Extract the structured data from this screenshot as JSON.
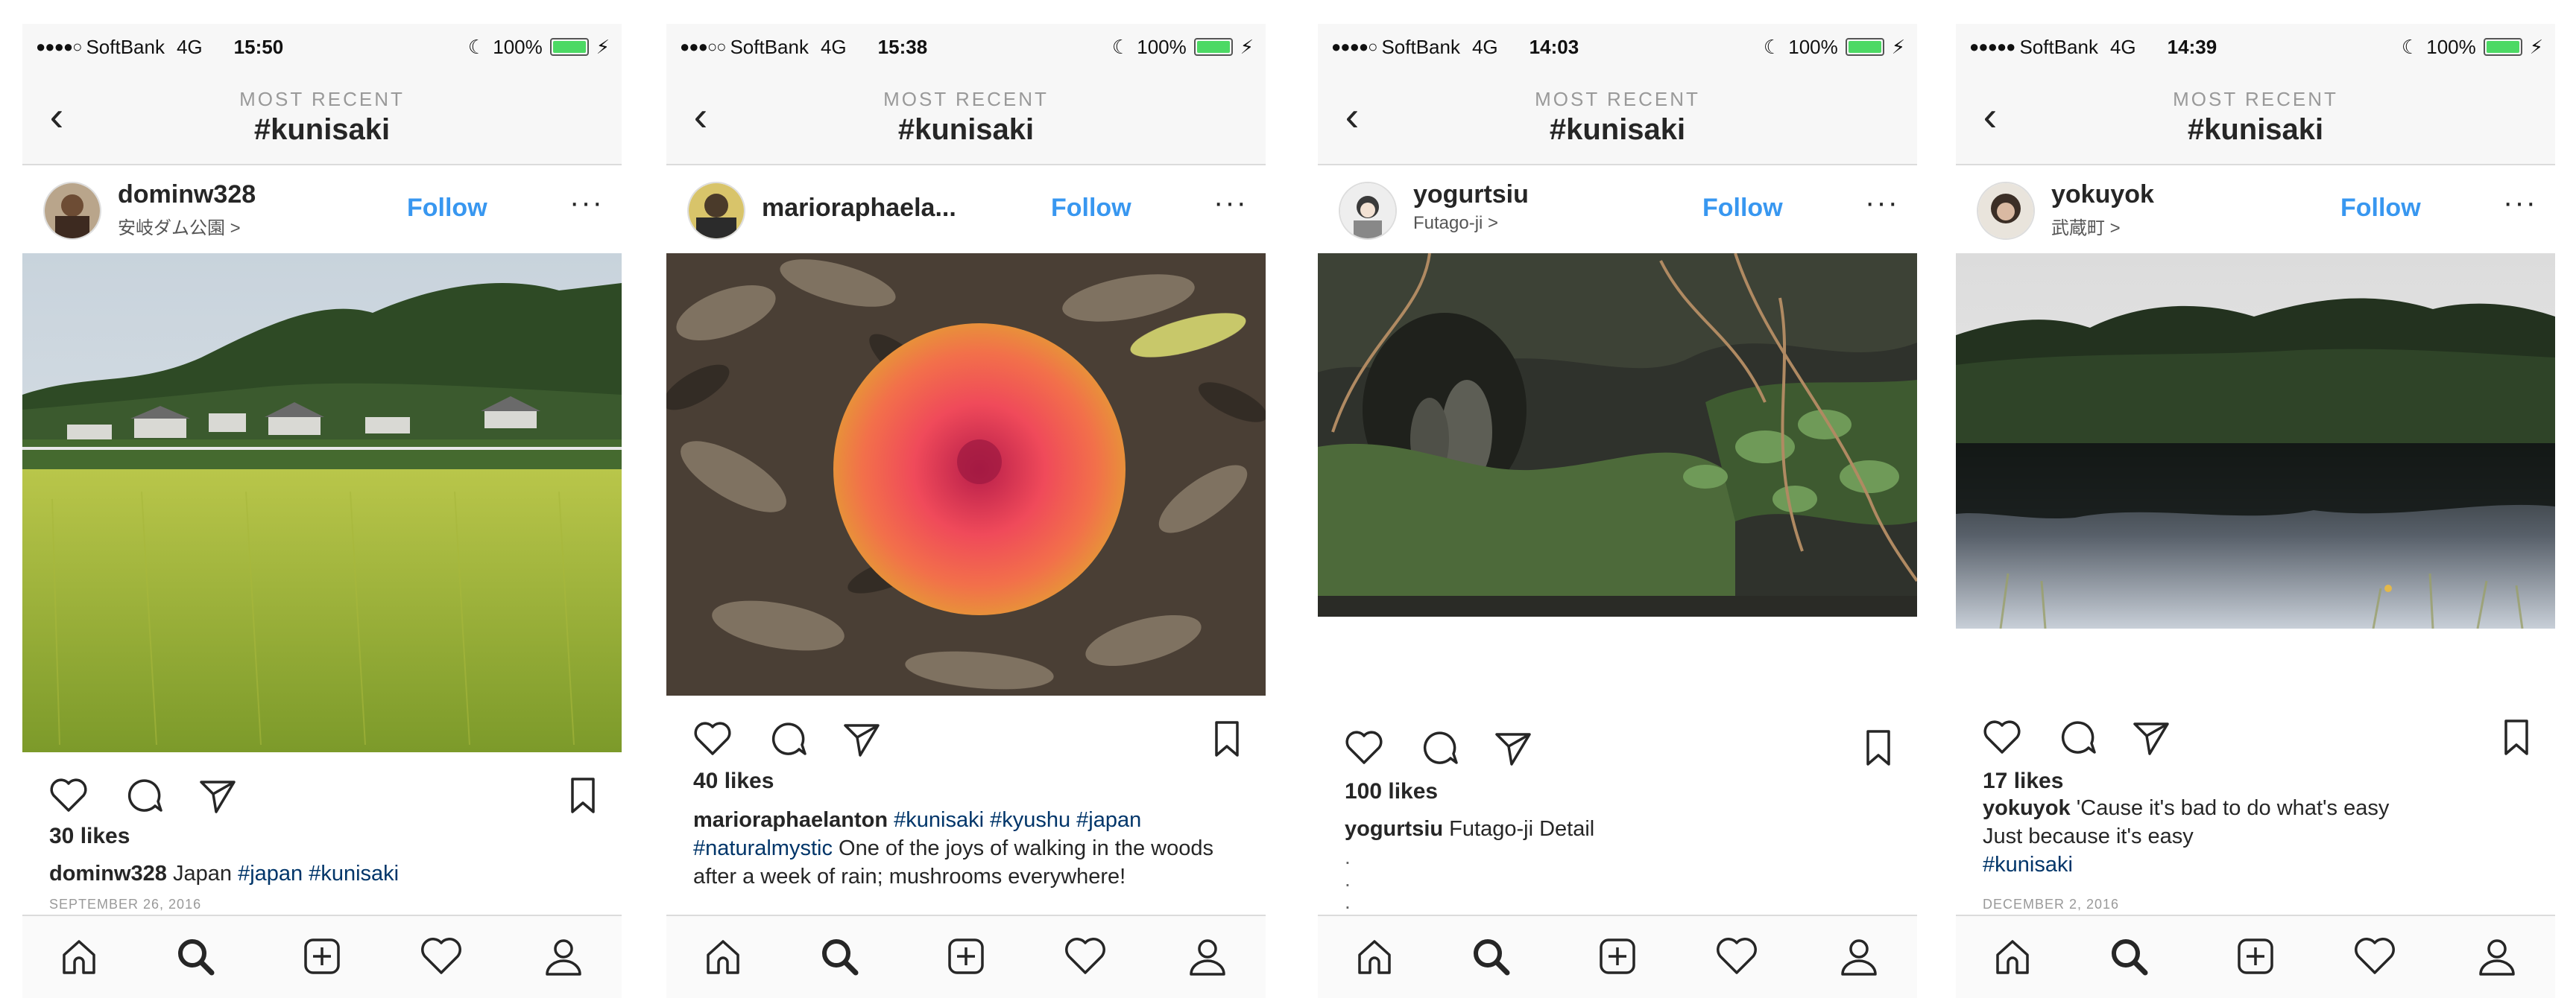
{
  "colors": {
    "link": "#3897f0",
    "hashtag": "#003569",
    "battery": "#4cd964"
  },
  "nav": {
    "subtitle": "MOST RECENT",
    "title": "#kunisaki"
  },
  "tabs": [
    "home-icon",
    "search-icon",
    "add-icon",
    "heart-icon",
    "profile-icon"
  ],
  "screens": [
    {
      "status": {
        "carrier": "SoftBank",
        "network": "4G",
        "time": "15:50",
        "battery": "100%"
      },
      "username": "dominw328",
      "location": "安岐ダム公園 >",
      "follow": "Follow",
      "photo": "rice field in front of a village and forested hills",
      "likes": "30 likes",
      "caption": {
        "user": "dominw328",
        "text": " Japan ",
        "tags": "#japan #kunisaki"
      },
      "date": "SEPTEMBER 26, 2016"
    },
    {
      "status": {
        "carrier": "SoftBank",
        "network": "4G",
        "time": "15:38",
        "battery": "100%"
      },
      "username": "marioraphaela...",
      "location": "",
      "follow": "Follow",
      "photo": "red mushroom cap among dead leaves",
      "likes": "40 likes",
      "caption": {
        "user": "marioraphaelanton",
        "tags1": " #kunisaki #kyushu",
        "tags2": "#japan #naturalmystic",
        "text": " One of the joys of walking in the woods after a week of rain; mushrooms everywhere!"
      }
    },
    {
      "status": {
        "carrier": "SoftBank",
        "network": "4G",
        "time": "14:03",
        "battery": "100%"
      },
      "username": "yogurtsiu",
      "location": "Futago-ji >",
      "follow": "Follow",
      "photo": "mossy rock face with stone carvings and roots",
      "likes": "100 likes",
      "caption": {
        "user": "yogurtsiu",
        "text": " Futago-ji Detail"
      },
      "dots": ".\n.\n."
    },
    {
      "status": {
        "carrier": "SoftBank",
        "network": "4G",
        "time": "14:39",
        "battery": "100%"
      },
      "username": "yokuyok",
      "location": "武蔵町 >",
      "follow": "Follow",
      "photo": "forest reflected in a calm lake",
      "likes": "17 likes",
      "caption": {
        "user": "yokuyok",
        "text1": " 'Cause it's bad to do what's easy",
        "text2": "Just because it's easy",
        "tags": "#kunisaki"
      },
      "date": "DECEMBER 2, 2016"
    }
  ]
}
